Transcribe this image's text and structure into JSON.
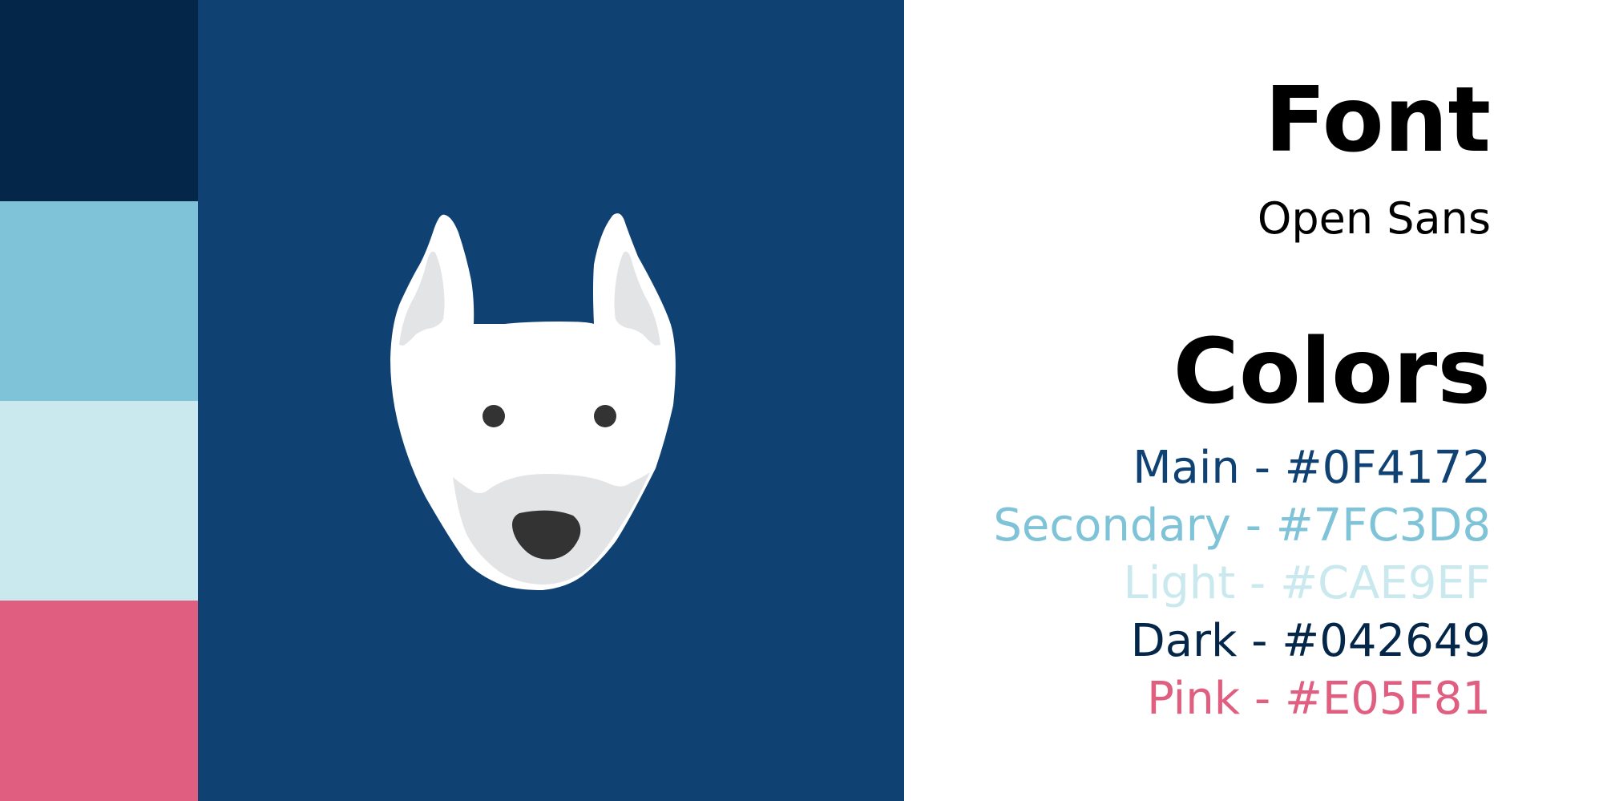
{
  "font_section": {
    "heading": "Font",
    "font_name": "Open Sans"
  },
  "colors_section": {
    "heading": "Colors",
    "entries": [
      {
        "label": "Main - #0F4172",
        "hex": "#0F4172"
      },
      {
        "label": "Secondary - #7FC3D8",
        "hex": "#7FC3D8"
      },
      {
        "label": "Light - #CAE9EF",
        "hex": "#CAE9EF"
      },
      {
        "label": "Dark - #042649",
        "hex": "#042649"
      },
      {
        "label": "Pink - #E05F81",
        "hex": "#E05F81"
      }
    ]
  },
  "swatches": [
    {
      "name": "dark",
      "hex": "#042649"
    },
    {
      "name": "secondary",
      "hex": "#7FC3D8"
    },
    {
      "name": "light",
      "hex": "#CAE9EF"
    },
    {
      "name": "pink",
      "hex": "#E05F81"
    }
  ],
  "logo": {
    "icon": "dog-face-icon",
    "background": "#0F4172"
  }
}
